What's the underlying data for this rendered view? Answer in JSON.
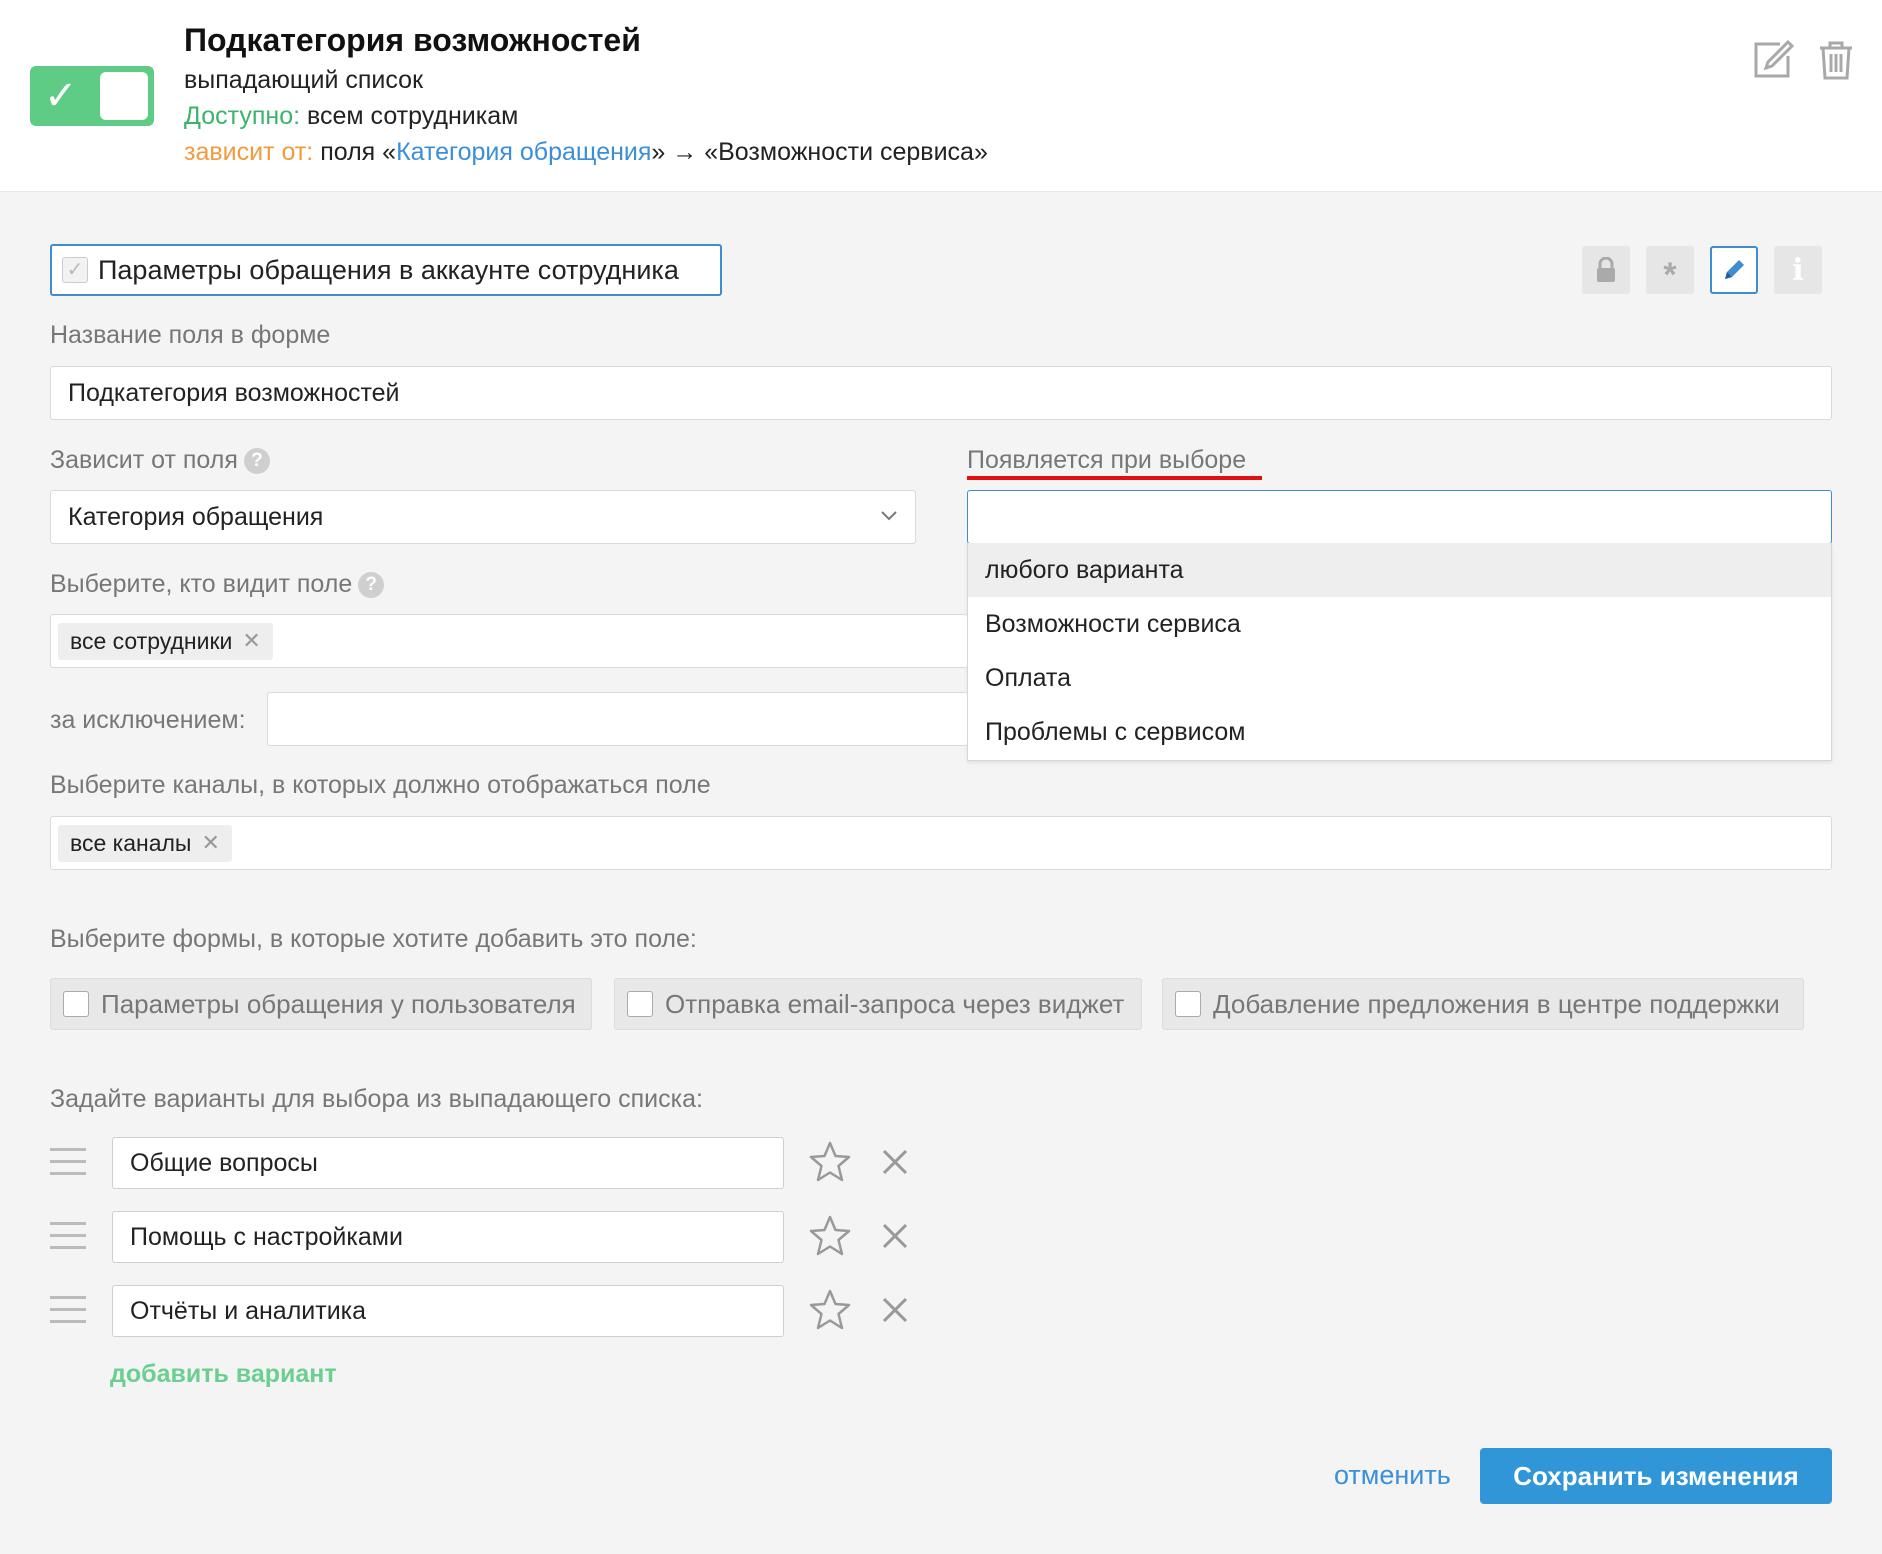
{
  "header": {
    "title": "Подкатегория возможностей",
    "type": "выпадающий список",
    "available_label": "Доступно:",
    "available_value": "всем сотрудникам",
    "depends_label": "зависит от:",
    "depends_prefix": "поля «",
    "depends_field": "Категория обращения",
    "depends_suffix": "» → «Возможности сервиса»",
    "toggle_on": true
  },
  "context": {
    "checkbox_label": "Параметры обращения в аккаунте сотрудника",
    "checked": true
  },
  "field_name": {
    "label": "Название поля в форме",
    "value": "Подкатегория возможностей"
  },
  "depends_on": {
    "label": "Зависит от поля",
    "value": "Категория обращения"
  },
  "appears_on": {
    "label": "Появляется при выборе",
    "value": "",
    "options": [
      "любого варианта",
      "Возможности сервиса",
      "Оплата",
      "Проблемы с сервисом"
    ]
  },
  "visibility": {
    "label": "Выберите, кто видит поле",
    "tags": [
      "все сотрудники"
    ],
    "except_label": "за исключением:",
    "except_value": ""
  },
  "channels": {
    "label": "Выберите каналы, в которых должно отображаться поле",
    "tags": [
      "все каналы"
    ]
  },
  "forms": {
    "label": "Выберите формы, в которые хотите добавить это поле:",
    "items": [
      "Параметры обращения у пользователя",
      "Отправка email-запроса через виджет",
      "Добавление предложения в центре поддержки"
    ]
  },
  "variants": {
    "label": "Задайте варианты для выбора из выпадающего списка:",
    "items": [
      "Общие вопросы",
      "Помощь с настройками",
      "Отчёты и аналитика"
    ],
    "add_label": "добавить вариант"
  },
  "actions": {
    "cancel": "отменить",
    "save": "Сохранить изменения"
  },
  "colors": {
    "accent_blue": "#3196d8",
    "green": "#5fcc85",
    "orange": "#f39b3b",
    "underline_red": "#e01010"
  }
}
